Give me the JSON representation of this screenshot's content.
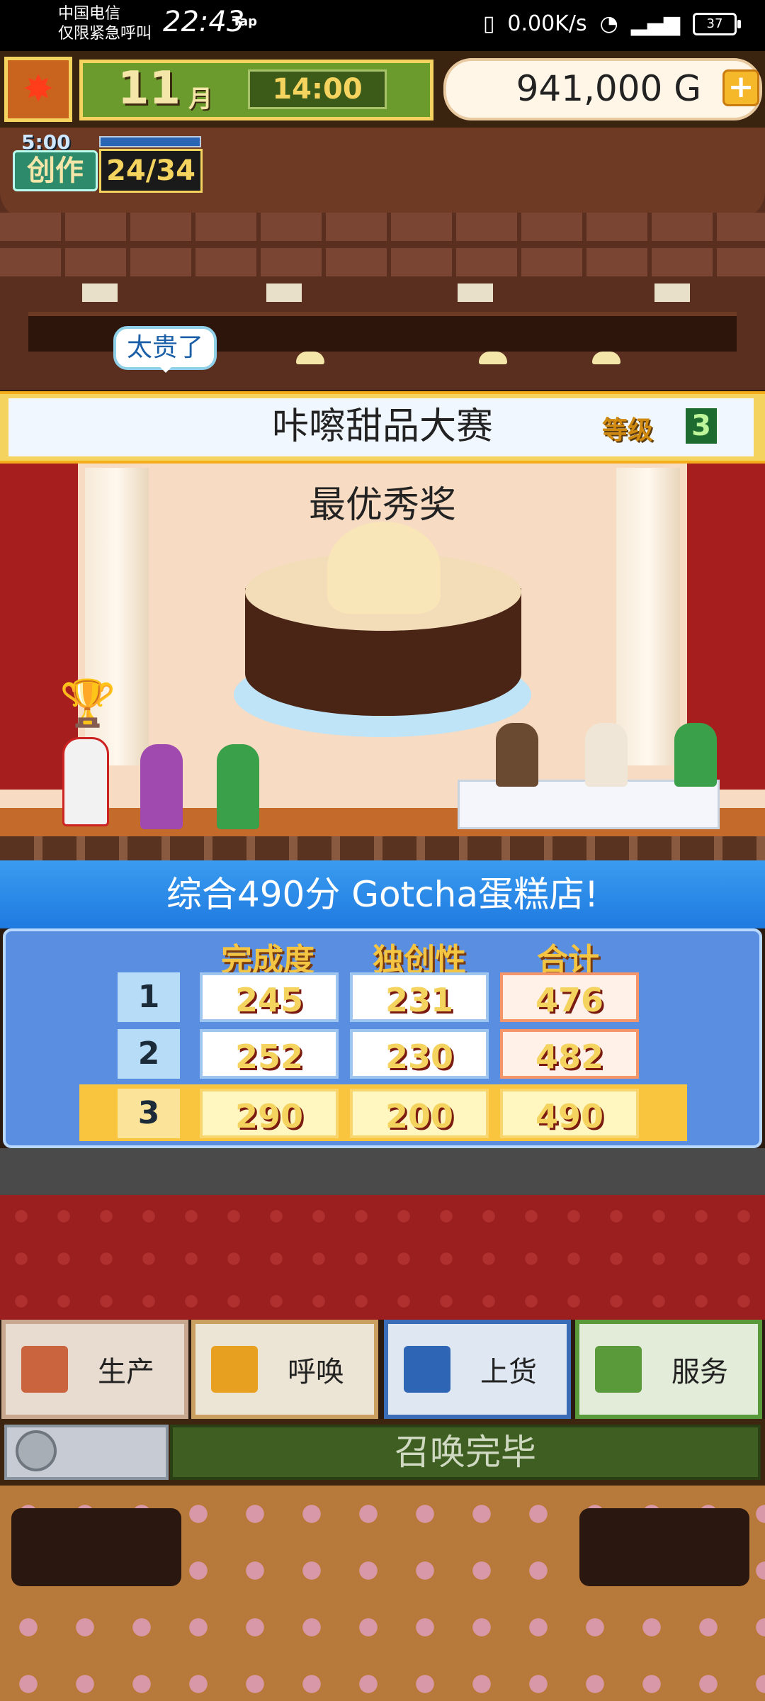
{
  "status_bar": {
    "carrier_line1": "中国电信",
    "carrier_line2": "仅限紧急呼叫",
    "clock": "22:43",
    "tap": "Tap",
    "net_speed": "0.00K/s",
    "battery": "37"
  },
  "hud": {
    "month_number": "11",
    "month_label": "月",
    "time": "14:00",
    "money": "941,000 G",
    "add_symbol": "+",
    "leaf_icon": "maple-leaf-icon"
  },
  "creation": {
    "time": "5:00",
    "label": "创作",
    "count": "24/34"
  },
  "customer_bubble": "太贵了",
  "contest": {
    "title": "咔嚓甜品大赛",
    "level_label": "等级",
    "level_value": "3"
  },
  "award": {
    "title": "最优秀奖"
  },
  "score": {
    "headline": "综合490分 Gotcha蛋糕店!",
    "headers": [
      "完成度",
      "独创性",
      "合计"
    ],
    "rows": [
      {
        "rank": "1",
        "completion": "245",
        "originality": "231",
        "total": "476"
      },
      {
        "rank": "2",
        "completion": "252",
        "originality": "230",
        "total": "482"
      },
      {
        "rank": "3",
        "completion": "290",
        "originality": "200",
        "total": "490"
      }
    ]
  },
  "menu": {
    "items": [
      {
        "label": "生产",
        "icon": "bread-icon"
      },
      {
        "label": "呼唤",
        "icon": "megaphone-flag-icon"
      },
      {
        "label": "上货",
        "icon": "cake-slice-icon"
      },
      {
        "label": "服务",
        "icon": "coffee-cup-icon"
      }
    ]
  },
  "call_status": "召唤完毕",
  "colors": {
    "accent_blue": "#1f7ae0",
    "gold": "#f4d35e",
    "green_hud": "#6b9b2c",
    "red_carpet": "#9b1f1f"
  }
}
